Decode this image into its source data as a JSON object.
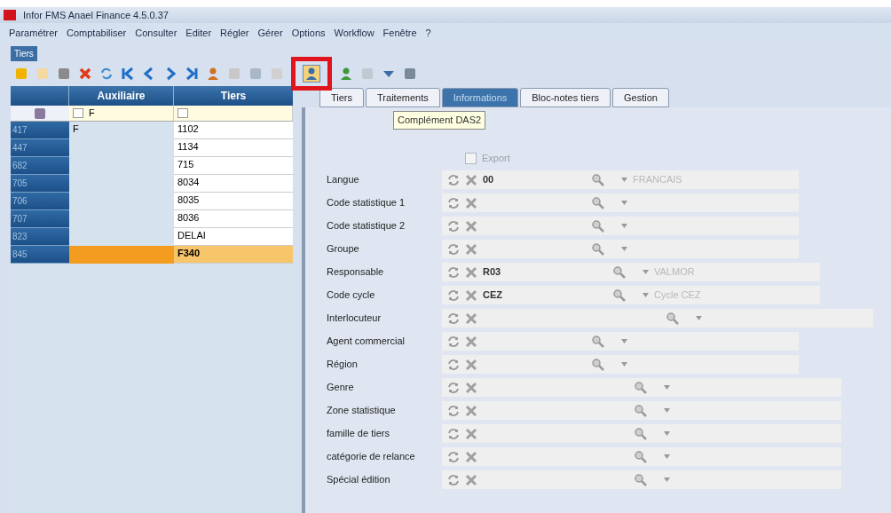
{
  "window": {
    "title": "Infor FMS Anael Finance 4.5.0.37"
  },
  "menu": [
    "Paramétrer",
    "Comptabiliser",
    "Consulter",
    "Editer",
    "Régler",
    "Gérer",
    "Options",
    "Workflow",
    "Fenêtre",
    "?"
  ],
  "doc_tab": {
    "label": "Tiers",
    "selected": true
  },
  "tooltip": "Complément DAS2",
  "grid": {
    "columns": [
      "Auxiliaire",
      "Tiers"
    ],
    "auxiliaire_filter": "F",
    "rows": [
      {
        "number": "417",
        "auxiliaire": "F",
        "tiers": "1102",
        "selected": false
      },
      {
        "number": "447",
        "tiers": "1134",
        "selected": false
      },
      {
        "number": "682",
        "tiers": "715",
        "selected": false
      },
      {
        "number": "705",
        "tiers": "8034",
        "selected": false
      },
      {
        "number": "706",
        "tiers": "8035",
        "selected": false
      },
      {
        "number": "707",
        "tiers": "8036",
        "selected": false
      },
      {
        "number": "823",
        "tiers": "DELAI",
        "selected": false
      },
      {
        "number": "845",
        "tiers": "F340",
        "selected": true
      }
    ]
  },
  "tabs": [
    {
      "label": "Tiers",
      "selected": false
    },
    {
      "label": "Traitements",
      "selected": false
    },
    {
      "label": "Informations",
      "selected": true
    },
    {
      "label": "Bloc-notes tiers",
      "selected": false
    },
    {
      "label": "Gestion",
      "selected": false
    }
  ],
  "export": {
    "label": "Export",
    "checked": false
  },
  "fields": [
    {
      "label": "Langue",
      "value": "00",
      "description": "FRANCAIS"
    },
    {
      "label": "Code statistique 1"
    },
    {
      "label": "Code statistique 2"
    },
    {
      "label": "Groupe"
    },
    {
      "label": "Responsable",
      "value": "R03",
      "description": "VALMOR"
    },
    {
      "label": "Code cycle",
      "value": "CEZ",
      "description": "Cycle CEZ"
    },
    {
      "label": "Interlocuteur"
    },
    {
      "label": "Agent commercial"
    },
    {
      "label": "Région"
    },
    {
      "label": "Genre"
    },
    {
      "label": "Zone statistique"
    },
    {
      "label": "famille de tiers"
    },
    {
      "label": "catégorie de relance"
    },
    {
      "label": "Spécial édition"
    }
  ]
}
